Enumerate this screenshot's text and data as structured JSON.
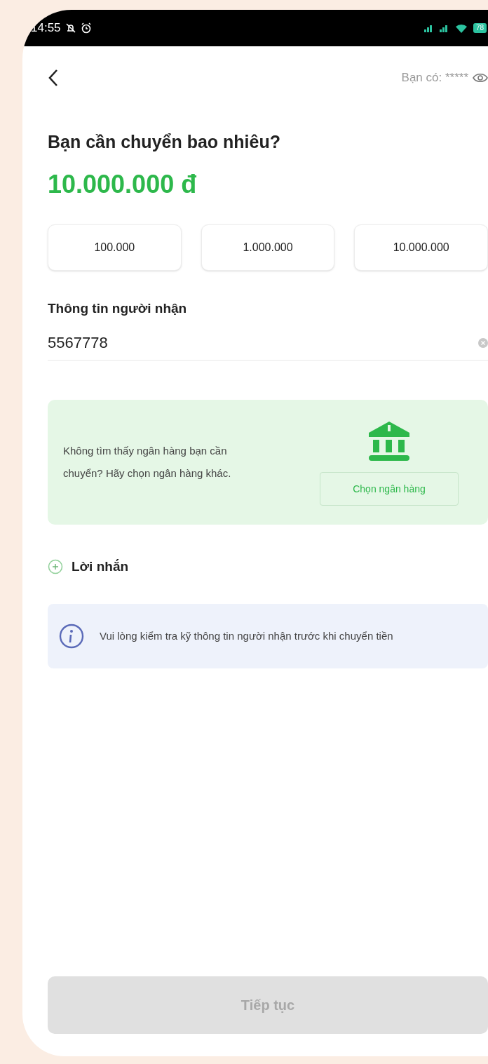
{
  "status_bar": {
    "time": "14:55",
    "battery": "78"
  },
  "header": {
    "balance_label": "Bạn có:",
    "balance_value": "*****"
  },
  "title": "Bạn cần chuyển bao nhiêu?",
  "amount": "10.000.000 đ",
  "quick_amounts": [
    "100.000",
    "1.000.000",
    "10.000.000"
  ],
  "recipient": {
    "label": "Thông tin người nhận",
    "value": "5567778"
  },
  "bank_card": {
    "text": "Không tìm thấy ngân hàng bạn cần chuyển? Hãy chọn ngân hàng khác.",
    "button": "Chọn ngân hàng"
  },
  "message_link": "Lời nhắn",
  "notice": "Vui lòng kiểm tra kỹ thông tin người nhận trước khi chuyển tiền",
  "continue_button": {
    "label": "Tiếp tục",
    "disabled": true
  }
}
